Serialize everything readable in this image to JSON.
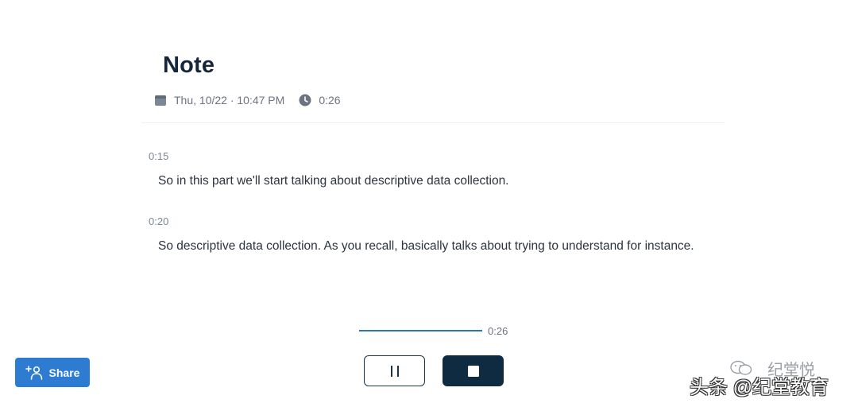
{
  "note": {
    "title": "Note",
    "date": "Thu, 10/22 · 10:47 PM",
    "duration": "0:26"
  },
  "transcript": [
    {
      "timestamp": "0:15",
      "text": "So in this part we'll start talking about descriptive data collection."
    },
    {
      "timestamp": "0:20",
      "text": "So descriptive data collection. As you recall, basically talks about trying to understand for instance."
    }
  ],
  "player": {
    "elapsed": "0:26",
    "progress_fraction": 1.0,
    "pause_icon": "pause-icon",
    "stop_icon": "stop-icon"
  },
  "share": {
    "label": "Share",
    "icon": "add-person-icon"
  },
  "watermark": {
    "top_text": "纪堂悦",
    "text": "头条 @纪堂教育"
  },
  "colors": {
    "title": "#14263a",
    "accent_blue": "#2d7cd1",
    "stop_button": "#0f2b42",
    "progress": "#2c73b8"
  }
}
